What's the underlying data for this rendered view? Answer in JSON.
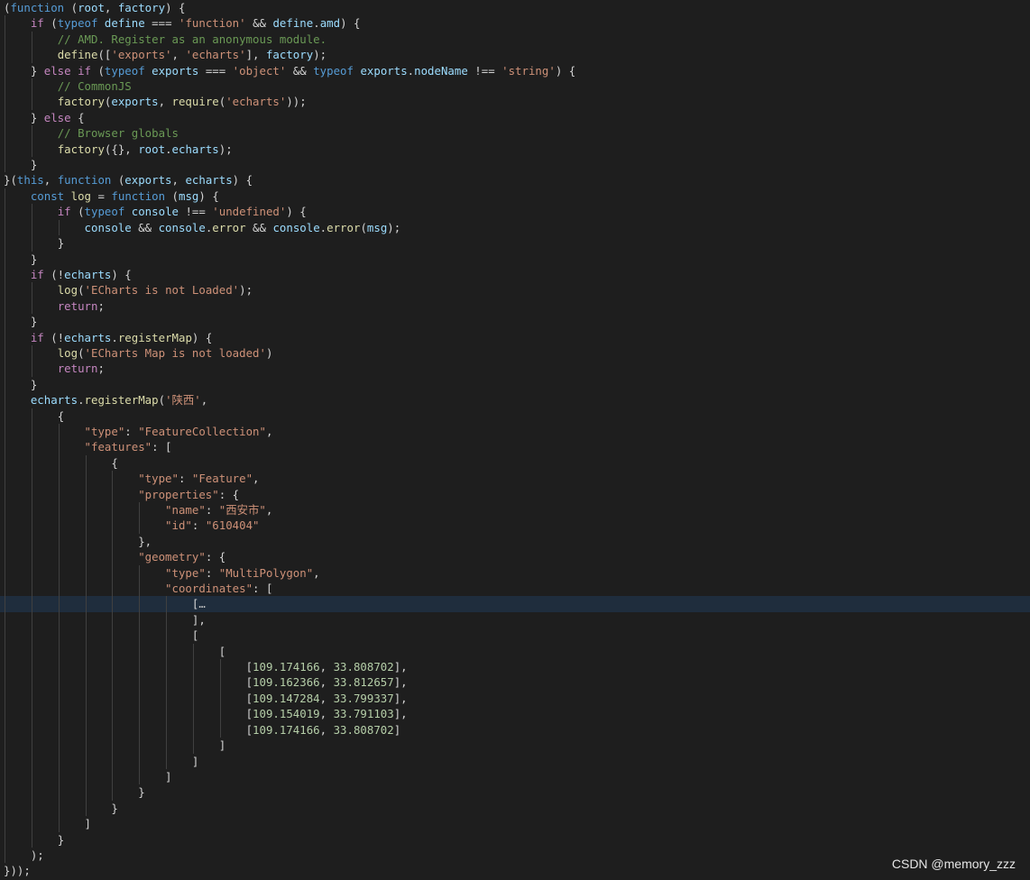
{
  "editor": {
    "theme": {
      "background": "#1e1e1e",
      "current_line": "#1f2d3d",
      "keyword": "#569cd6",
      "control": "#c586c0",
      "function": "#dcdcaa",
      "variable": "#9cdcfe",
      "string": "#ce9178",
      "number": "#b5cea8",
      "comment": "#6a9955"
    },
    "current_line_index": 38,
    "folded_region_marker": "…",
    "lines": [
      {
        "indent": 0,
        "tokens": [
          [
            "punc",
            "("
          ],
          [
            "kw",
            "function"
          ],
          [
            "punc",
            " ("
          ],
          [
            "var",
            "root"
          ],
          [
            "punc",
            ", "
          ],
          [
            "var",
            "factory"
          ],
          [
            "punc",
            ") {"
          ]
        ]
      },
      {
        "indent": 1,
        "tokens": [
          [
            "ctl",
            "if"
          ],
          [
            "punc",
            " ("
          ],
          [
            "kw",
            "typeof"
          ],
          [
            "punc",
            " "
          ],
          [
            "var",
            "define"
          ],
          [
            "punc",
            " === "
          ],
          [
            "str",
            "'function'"
          ],
          [
            "punc",
            " && "
          ],
          [
            "var",
            "define"
          ],
          [
            "punc",
            "."
          ],
          [
            "var",
            "amd"
          ],
          [
            "punc",
            ") {"
          ]
        ]
      },
      {
        "indent": 2,
        "tokens": [
          [
            "cmt",
            "// AMD. Register as an anonymous module."
          ]
        ]
      },
      {
        "indent": 2,
        "tokens": [
          [
            "fn",
            "define"
          ],
          [
            "punc",
            "(["
          ],
          [
            "str",
            "'exports'"
          ],
          [
            "punc",
            ", "
          ],
          [
            "str",
            "'echarts'"
          ],
          [
            "punc",
            "], "
          ],
          [
            "var",
            "factory"
          ],
          [
            "punc",
            ");"
          ]
        ]
      },
      {
        "indent": 1,
        "tokens": [
          [
            "punc",
            "} "
          ],
          [
            "ctl",
            "else if"
          ],
          [
            "punc",
            " ("
          ],
          [
            "kw",
            "typeof"
          ],
          [
            "punc",
            " "
          ],
          [
            "var",
            "exports"
          ],
          [
            "punc",
            " === "
          ],
          [
            "str",
            "'object'"
          ],
          [
            "punc",
            " && "
          ],
          [
            "kw",
            "typeof"
          ],
          [
            "punc",
            " "
          ],
          [
            "var",
            "exports"
          ],
          [
            "punc",
            "."
          ],
          [
            "var",
            "nodeName"
          ],
          [
            "punc",
            " !== "
          ],
          [
            "str",
            "'string'"
          ],
          [
            "punc",
            ") {"
          ]
        ]
      },
      {
        "indent": 2,
        "tokens": [
          [
            "cmt",
            "// CommonJS"
          ]
        ]
      },
      {
        "indent": 2,
        "tokens": [
          [
            "fn",
            "factory"
          ],
          [
            "punc",
            "("
          ],
          [
            "var",
            "exports"
          ],
          [
            "punc",
            ", "
          ],
          [
            "fn",
            "require"
          ],
          [
            "punc",
            "("
          ],
          [
            "str",
            "'echarts'"
          ],
          [
            "punc",
            "));"
          ]
        ]
      },
      {
        "indent": 1,
        "tokens": [
          [
            "punc",
            "} "
          ],
          [
            "ctl",
            "else"
          ],
          [
            "punc",
            " {"
          ]
        ]
      },
      {
        "indent": 2,
        "tokens": [
          [
            "cmt",
            "// Browser globals"
          ]
        ]
      },
      {
        "indent": 2,
        "tokens": [
          [
            "fn",
            "factory"
          ],
          [
            "punc",
            "({}, "
          ],
          [
            "var",
            "root"
          ],
          [
            "punc",
            "."
          ],
          [
            "var",
            "echarts"
          ],
          [
            "punc",
            ");"
          ]
        ]
      },
      {
        "indent": 1,
        "tokens": [
          [
            "punc",
            "}"
          ]
        ]
      },
      {
        "indent": 0,
        "tokens": [
          [
            "punc",
            "}("
          ],
          [
            "kw",
            "this"
          ],
          [
            "punc",
            ", "
          ],
          [
            "kw",
            "function"
          ],
          [
            "punc",
            " ("
          ],
          [
            "var",
            "exports"
          ],
          [
            "punc",
            ", "
          ],
          [
            "var",
            "echarts"
          ],
          [
            "punc",
            ") {"
          ]
        ]
      },
      {
        "indent": 1,
        "tokens": [
          [
            "kw",
            "const"
          ],
          [
            "punc",
            " "
          ],
          [
            "fn",
            "log"
          ],
          [
            "punc",
            " = "
          ],
          [
            "kw",
            "function"
          ],
          [
            "punc",
            " ("
          ],
          [
            "var",
            "msg"
          ],
          [
            "punc",
            ") {"
          ]
        ]
      },
      {
        "indent": 2,
        "tokens": [
          [
            "ctl",
            "if"
          ],
          [
            "punc",
            " ("
          ],
          [
            "kw",
            "typeof"
          ],
          [
            "punc",
            " "
          ],
          [
            "var",
            "console"
          ],
          [
            "punc",
            " !== "
          ],
          [
            "str",
            "'undefined'"
          ],
          [
            "punc",
            ") {"
          ]
        ]
      },
      {
        "indent": 3,
        "tokens": [
          [
            "var",
            "console"
          ],
          [
            "punc",
            " && "
          ],
          [
            "var",
            "console"
          ],
          [
            "punc",
            "."
          ],
          [
            "fn",
            "error"
          ],
          [
            "punc",
            " && "
          ],
          [
            "var",
            "console"
          ],
          [
            "punc",
            "."
          ],
          [
            "fn",
            "error"
          ],
          [
            "punc",
            "("
          ],
          [
            "var",
            "msg"
          ],
          [
            "punc",
            ");"
          ]
        ]
      },
      {
        "indent": 2,
        "tokens": [
          [
            "punc",
            "}"
          ]
        ]
      },
      {
        "indent": 1,
        "tokens": [
          [
            "punc",
            "}"
          ]
        ]
      },
      {
        "indent": 1,
        "tokens": [
          [
            "ctl",
            "if"
          ],
          [
            "punc",
            " (!"
          ],
          [
            "var",
            "echarts"
          ],
          [
            "punc",
            ") {"
          ]
        ]
      },
      {
        "indent": 2,
        "tokens": [
          [
            "fn",
            "log"
          ],
          [
            "punc",
            "("
          ],
          [
            "str",
            "'ECharts is not Loaded'"
          ],
          [
            "punc",
            ");"
          ]
        ]
      },
      {
        "indent": 2,
        "tokens": [
          [
            "ctl",
            "return"
          ],
          [
            "punc",
            ";"
          ]
        ]
      },
      {
        "indent": 1,
        "tokens": [
          [
            "punc",
            "}"
          ]
        ]
      },
      {
        "indent": 1,
        "tokens": [
          [
            "ctl",
            "if"
          ],
          [
            "punc",
            " (!"
          ],
          [
            "var",
            "echarts"
          ],
          [
            "punc",
            "."
          ],
          [
            "fn",
            "registerMap"
          ],
          [
            "punc",
            ") {"
          ]
        ]
      },
      {
        "indent": 2,
        "tokens": [
          [
            "fn",
            "log"
          ],
          [
            "punc",
            "("
          ],
          [
            "str",
            "'ECharts Map is not loaded'"
          ],
          [
            "punc",
            ")"
          ]
        ]
      },
      {
        "indent": 2,
        "tokens": [
          [
            "ctl",
            "return"
          ],
          [
            "punc",
            ";"
          ]
        ]
      },
      {
        "indent": 1,
        "tokens": [
          [
            "punc",
            "}"
          ]
        ]
      },
      {
        "indent": 1,
        "tokens": [
          [
            "var",
            "echarts"
          ],
          [
            "punc",
            "."
          ],
          [
            "fn",
            "registerMap"
          ],
          [
            "punc",
            "("
          ],
          [
            "str",
            "'陕西'"
          ],
          [
            "punc",
            ","
          ]
        ]
      },
      {
        "indent": 2,
        "tokens": [
          [
            "punc",
            "{"
          ]
        ]
      },
      {
        "indent": 3,
        "tokens": [
          [
            "str",
            "\"type\""
          ],
          [
            "punc",
            ": "
          ],
          [
            "str",
            "\"FeatureCollection\""
          ],
          [
            "punc",
            ","
          ]
        ]
      },
      {
        "indent": 3,
        "tokens": [
          [
            "str",
            "\"features\""
          ],
          [
            "punc",
            ": ["
          ]
        ]
      },
      {
        "indent": 4,
        "tokens": [
          [
            "punc",
            "{"
          ]
        ]
      },
      {
        "indent": 5,
        "tokens": [
          [
            "str",
            "\"type\""
          ],
          [
            "punc",
            ": "
          ],
          [
            "str",
            "\"Feature\""
          ],
          [
            "punc",
            ","
          ]
        ]
      },
      {
        "indent": 5,
        "tokens": [
          [
            "str",
            "\"properties\""
          ],
          [
            "punc",
            ": {"
          ]
        ]
      },
      {
        "indent": 6,
        "tokens": [
          [
            "str",
            "\"name\""
          ],
          [
            "punc",
            ": "
          ],
          [
            "str",
            "\"西安市\""
          ],
          [
            "punc",
            ","
          ]
        ]
      },
      {
        "indent": 6,
        "tokens": [
          [
            "str",
            "\"id\""
          ],
          [
            "punc",
            ": "
          ],
          [
            "str",
            "\"610404\""
          ]
        ]
      },
      {
        "indent": 5,
        "tokens": [
          [
            "punc",
            "},"
          ]
        ]
      },
      {
        "indent": 5,
        "tokens": [
          [
            "str",
            "\"geometry\""
          ],
          [
            "punc",
            ": {"
          ]
        ]
      },
      {
        "indent": 6,
        "tokens": [
          [
            "str",
            "\"type\""
          ],
          [
            "punc",
            ": "
          ],
          [
            "str",
            "\"MultiPolygon\""
          ],
          [
            "punc",
            ","
          ]
        ]
      },
      {
        "indent": 6,
        "tokens": [
          [
            "str",
            "\"coordinates\""
          ],
          [
            "punc",
            ": ["
          ]
        ]
      },
      {
        "indent": 7,
        "tokens": [
          [
            "punc",
            "["
          ],
          [
            "fold",
            "…"
          ]
        ]
      },
      {
        "indent": 7,
        "tokens": [
          [
            "punc",
            "],"
          ]
        ]
      },
      {
        "indent": 7,
        "tokens": [
          [
            "punc",
            "["
          ]
        ]
      },
      {
        "indent": 8,
        "tokens": [
          [
            "punc",
            "["
          ]
        ]
      },
      {
        "indent": 9,
        "tokens": [
          [
            "punc",
            "["
          ],
          [
            "num",
            "109.174166"
          ],
          [
            "punc",
            ", "
          ],
          [
            "num",
            "33.808702"
          ],
          [
            "punc",
            "],"
          ]
        ]
      },
      {
        "indent": 9,
        "tokens": [
          [
            "punc",
            "["
          ],
          [
            "num",
            "109.162366"
          ],
          [
            "punc",
            ", "
          ],
          [
            "num",
            "33.812657"
          ],
          [
            "punc",
            "],"
          ]
        ]
      },
      {
        "indent": 9,
        "tokens": [
          [
            "punc",
            "["
          ],
          [
            "num",
            "109.147284"
          ],
          [
            "punc",
            ", "
          ],
          [
            "num",
            "33.799337"
          ],
          [
            "punc",
            "],"
          ]
        ]
      },
      {
        "indent": 9,
        "tokens": [
          [
            "punc",
            "["
          ],
          [
            "num",
            "109.154019"
          ],
          [
            "punc",
            ", "
          ],
          [
            "num",
            "33.791103"
          ],
          [
            "punc",
            "],"
          ]
        ]
      },
      {
        "indent": 9,
        "tokens": [
          [
            "punc",
            "["
          ],
          [
            "num",
            "109.174166"
          ],
          [
            "punc",
            ", "
          ],
          [
            "num",
            "33.808702"
          ],
          [
            "punc",
            "]"
          ]
        ]
      },
      {
        "indent": 8,
        "tokens": [
          [
            "punc",
            "]"
          ]
        ]
      },
      {
        "indent": 7,
        "tokens": [
          [
            "punc",
            "]"
          ]
        ]
      },
      {
        "indent": 6,
        "tokens": [
          [
            "punc",
            "]"
          ]
        ]
      },
      {
        "indent": 5,
        "tokens": [
          [
            "punc",
            "}"
          ]
        ]
      },
      {
        "indent": 4,
        "tokens": [
          [
            "punc",
            "}"
          ]
        ]
      },
      {
        "indent": 3,
        "tokens": [
          [
            "punc",
            "]"
          ]
        ]
      },
      {
        "indent": 2,
        "tokens": [
          [
            "punc",
            "}"
          ]
        ]
      },
      {
        "indent": 1,
        "tokens": [
          [
            "punc",
            ");"
          ]
        ]
      },
      {
        "indent": 0,
        "tokens": [
          [
            "punc",
            "}));"
          ]
        ]
      }
    ]
  },
  "watermark": {
    "text": "CSDN @memory_zzz"
  }
}
